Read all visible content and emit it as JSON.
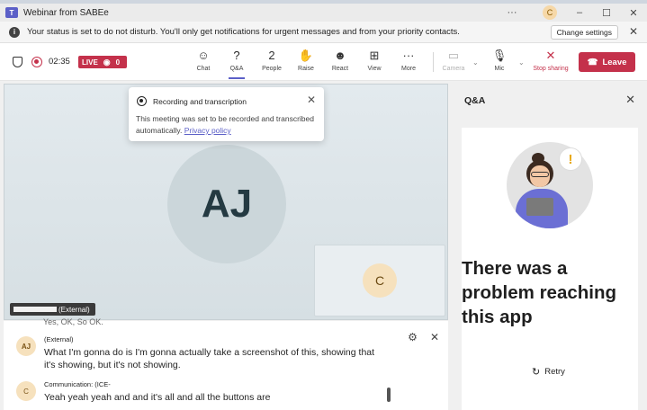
{
  "window": {
    "title": "Webinar from SABEe",
    "more": "···",
    "user_initial": "C",
    "minimize": "–",
    "maximize": "☐",
    "close": "✕"
  },
  "notice": {
    "text": "Your status is set to do not disturb. You'll only get notifications for urgent messages and from your priority contacts.",
    "change_button": "Change settings",
    "close": "✕"
  },
  "meeting": {
    "timer": "02:35",
    "live_label": "LIVE",
    "viewer_count": "0"
  },
  "toolbar": [
    {
      "id": "chat",
      "label": "Chat",
      "icon": "☺",
      "state": "normal"
    },
    {
      "id": "qa",
      "label": "Q&A",
      "icon": "?",
      "state": "active"
    },
    {
      "id": "people",
      "label": "People",
      "icon": "2",
      "state": "normal"
    },
    {
      "id": "raise",
      "label": "Raise",
      "icon": "✋",
      "state": "normal"
    },
    {
      "id": "react",
      "label": "React",
      "icon": "☻",
      "state": "normal"
    },
    {
      "id": "view",
      "label": "View",
      "icon": "⊞",
      "state": "normal"
    },
    {
      "id": "more",
      "label": "More",
      "icon": "···",
      "state": "normal"
    },
    {
      "id": "camera",
      "label": "Camera",
      "icon": "▭",
      "state": "disabled"
    },
    {
      "id": "mic",
      "label": "Mic",
      "icon": "🎙",
      "state": "normal"
    },
    {
      "id": "stop_sharing",
      "label": "Stop sharing",
      "icon": "✕",
      "state": "stop"
    }
  ],
  "leave_label": "Leave",
  "stage": {
    "main_initials": "AJ",
    "pip_initial": "C",
    "name_tag": "(External)"
  },
  "popup": {
    "title": "Recording and transcription",
    "body": "This meeting was set to be recorded and transcribed automatically.",
    "link": "Privacy policy",
    "close": "✕"
  },
  "chat": {
    "cutoff_line": "Yes, OK, So OK.",
    "messages": [
      {
        "initials": "AJ",
        "sender": "(External)",
        "text": "What I'm gonna do is I'm gonna actually take a screenshot of this, showing that it's showing, but it's not showing."
      },
      {
        "initials": "C",
        "sender": "Communication: (ICE-",
        "text": "Yeah yeah yeah and and it's all and all the buttons are"
      }
    ],
    "settings_icon": "⚙",
    "close_icon": "✕"
  },
  "qa_panel": {
    "title": "Q&A",
    "close": "✕",
    "error": "There was a problem reaching this app",
    "bubble": "!",
    "retry": "Retry"
  }
}
